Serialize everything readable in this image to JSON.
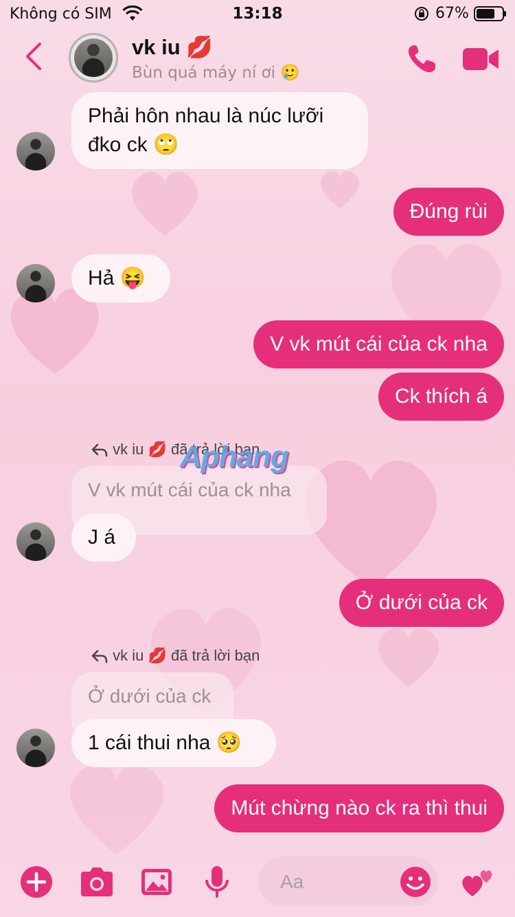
{
  "status_bar": {
    "carrier": "Không có SIM",
    "time": "13:18",
    "battery": "67%"
  },
  "header": {
    "name": "vk iu 💋",
    "status": "Bùn quá máy ní ơi 🥲"
  },
  "messages": [
    {
      "side": "in",
      "text": "Phải hôn nhau là núc lưỡi đko ck 🙄"
    },
    {
      "side": "out",
      "text": "Đúng rùi"
    },
    {
      "side": "in",
      "text": "Hả 😝"
    },
    {
      "side": "out",
      "text": "V vk mút cái của ck nha"
    },
    {
      "side": "out",
      "text": "Ck thích á"
    },
    {
      "side": "in",
      "reply_label": "vk iu 💋 đã trả lời bạn",
      "quoted": "V vk mút cái của ck nha",
      "text": "J á"
    },
    {
      "side": "out",
      "text": "Ở dưới của ck"
    },
    {
      "side": "in",
      "reply_label": "vk iu 💋 đã trả lời bạn",
      "quoted": "Ở dưới của ck",
      "text": "1 cái thui nha 🥺"
    },
    {
      "side": "out",
      "text": "Mút chừng nào ck ra thì thui"
    }
  ],
  "watermark": "Aphang",
  "composer": {
    "placeholder": "Aa"
  },
  "colors": {
    "accent": "#e52f7a",
    "incoming_bubble": "#fdf3f6",
    "background": "#f8d6e6"
  },
  "icons": [
    "back-icon",
    "phone-icon",
    "video-camera-icon",
    "plus-icon",
    "camera-icon",
    "image-icon",
    "microphone-icon",
    "emoji-icon",
    "hearts-icon"
  ]
}
